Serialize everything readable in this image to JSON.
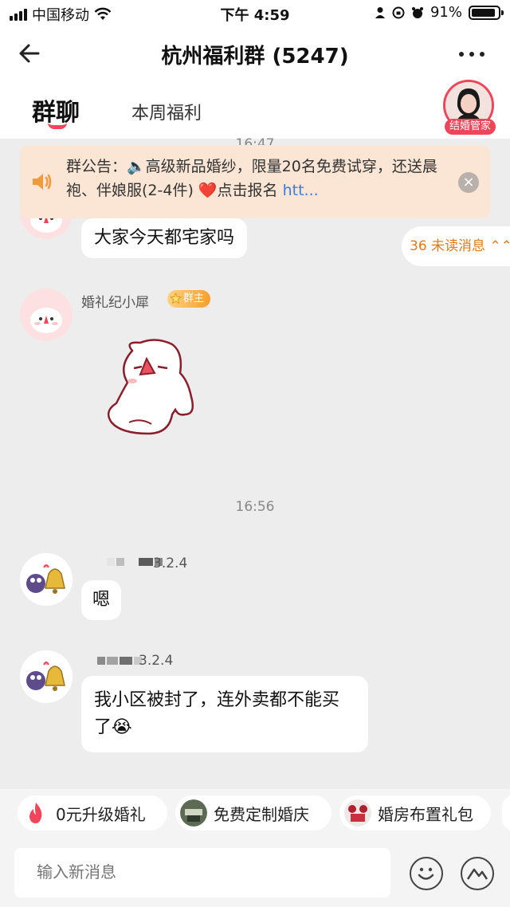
{
  "status_bar": {
    "carrier": "中国移动",
    "time": "下午 4:59",
    "battery": "91%",
    "battery_level": 0.91
  },
  "header": {
    "title": "杭州福利群 (5247)"
  },
  "tabs": [
    {
      "label": "群聊"
    },
    {
      "label": "本周福利"
    }
  ],
  "manager": {
    "label": "结婚管家"
  },
  "notice": {
    "prefix": "群公告：🔈高级新品婚纱，限量20名免费试穿，还送晨袍、伴娘服(2-4件) ❤️点击报名 ",
    "link": "htt..."
  },
  "timestamps": {
    "partial": "16:47",
    "main": "16:56"
  },
  "unread": {
    "label": "36 未读消息 ⌃⌃"
  },
  "messages": [
    {
      "text": "大家今天都宅家吗"
    },
    {
      "sender": "婚礼纪小犀",
      "badge": "群主"
    },
    {
      "sender_suffix": "3.2.4",
      "text": "嗯"
    },
    {
      "sender_suffix": "3.2.4",
      "text": "我小区被封了，连外卖都不能买了😭"
    }
  ],
  "quick_actions": [
    {
      "label": "0元升级婚礼"
    },
    {
      "label": "免费定制婚庆"
    },
    {
      "label": "婚房布置礼包"
    }
  ],
  "input": {
    "placeholder": "输入新消息"
  },
  "colors": {
    "accent": "#f0455a",
    "notice_bg": "#fbe5d4",
    "link": "#3f7bd6",
    "unread": "#e07a1a"
  }
}
